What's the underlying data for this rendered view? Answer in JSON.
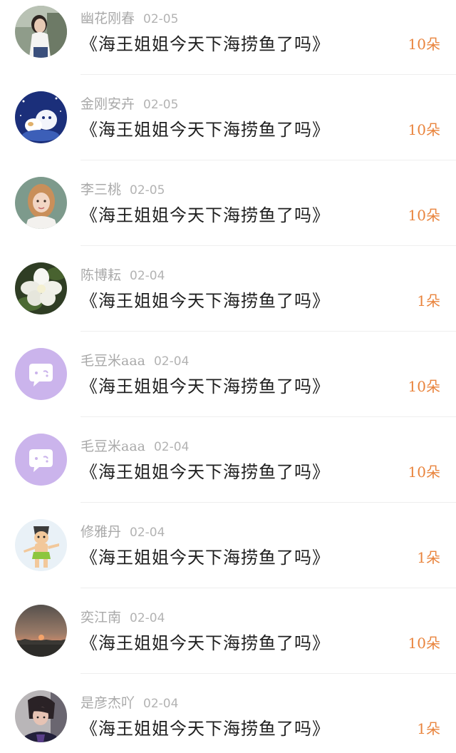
{
  "list": {
    "items": [
      {
        "name": "幽花刚春",
        "date": "02-05",
        "title": "《海王姐姐今天下海捞鱼了吗》",
        "count": "10朵",
        "avatar": "woman-portrait-avatar"
      },
      {
        "name": "金刚安卉",
        "date": "02-05",
        "title": "《海王姐姐今天下海捞鱼了吗》",
        "count": "10朵",
        "avatar": "cartoon-animals-avatar"
      },
      {
        "name": "李三桃",
        "date": "02-05",
        "title": "《海王姐姐今天下海捞鱼了吗》",
        "count": "10朵",
        "avatar": "woman-portrait-avatar"
      },
      {
        "name": "陈博耘",
        "date": "02-04",
        "title": "《海王姐姐今天下海捞鱼了吗》",
        "count": "1朵",
        "avatar": "white-flower-avatar"
      },
      {
        "name": "毛豆米aaa",
        "date": "02-04",
        "title": "《海王姐姐今天下海捞鱼了吗》",
        "count": "10朵",
        "avatar": "default-chat-bubble-avatar"
      },
      {
        "name": "毛豆米aaa",
        "date": "02-04",
        "title": "《海王姐姐今天下海捞鱼了吗》",
        "count": "10朵",
        "avatar": "default-chat-bubble-avatar"
      },
      {
        "name": "修雅丹",
        "date": "02-04",
        "title": "《海王姐姐今天下海捞鱼了吗》",
        "count": "1朵",
        "avatar": "cartoon-boy-avatar"
      },
      {
        "name": "奕江南",
        "date": "02-04",
        "title": "《海王姐姐今天下海捞鱼了吗》",
        "count": "10朵",
        "avatar": "sunset-avatar"
      },
      {
        "name": "是彦杰吖",
        "date": "02-04",
        "title": "《海王姐姐今天下海捞鱼了吗》",
        "count": "1朵",
        "avatar": "man-portrait-avatar"
      }
    ]
  },
  "colors": {
    "name_text": "#a9a9a9",
    "title_text": "#1f1f1f",
    "count_accent": "#e9843d",
    "default_avatar": "#cbb4ec",
    "divider": "#eeeeee"
  }
}
